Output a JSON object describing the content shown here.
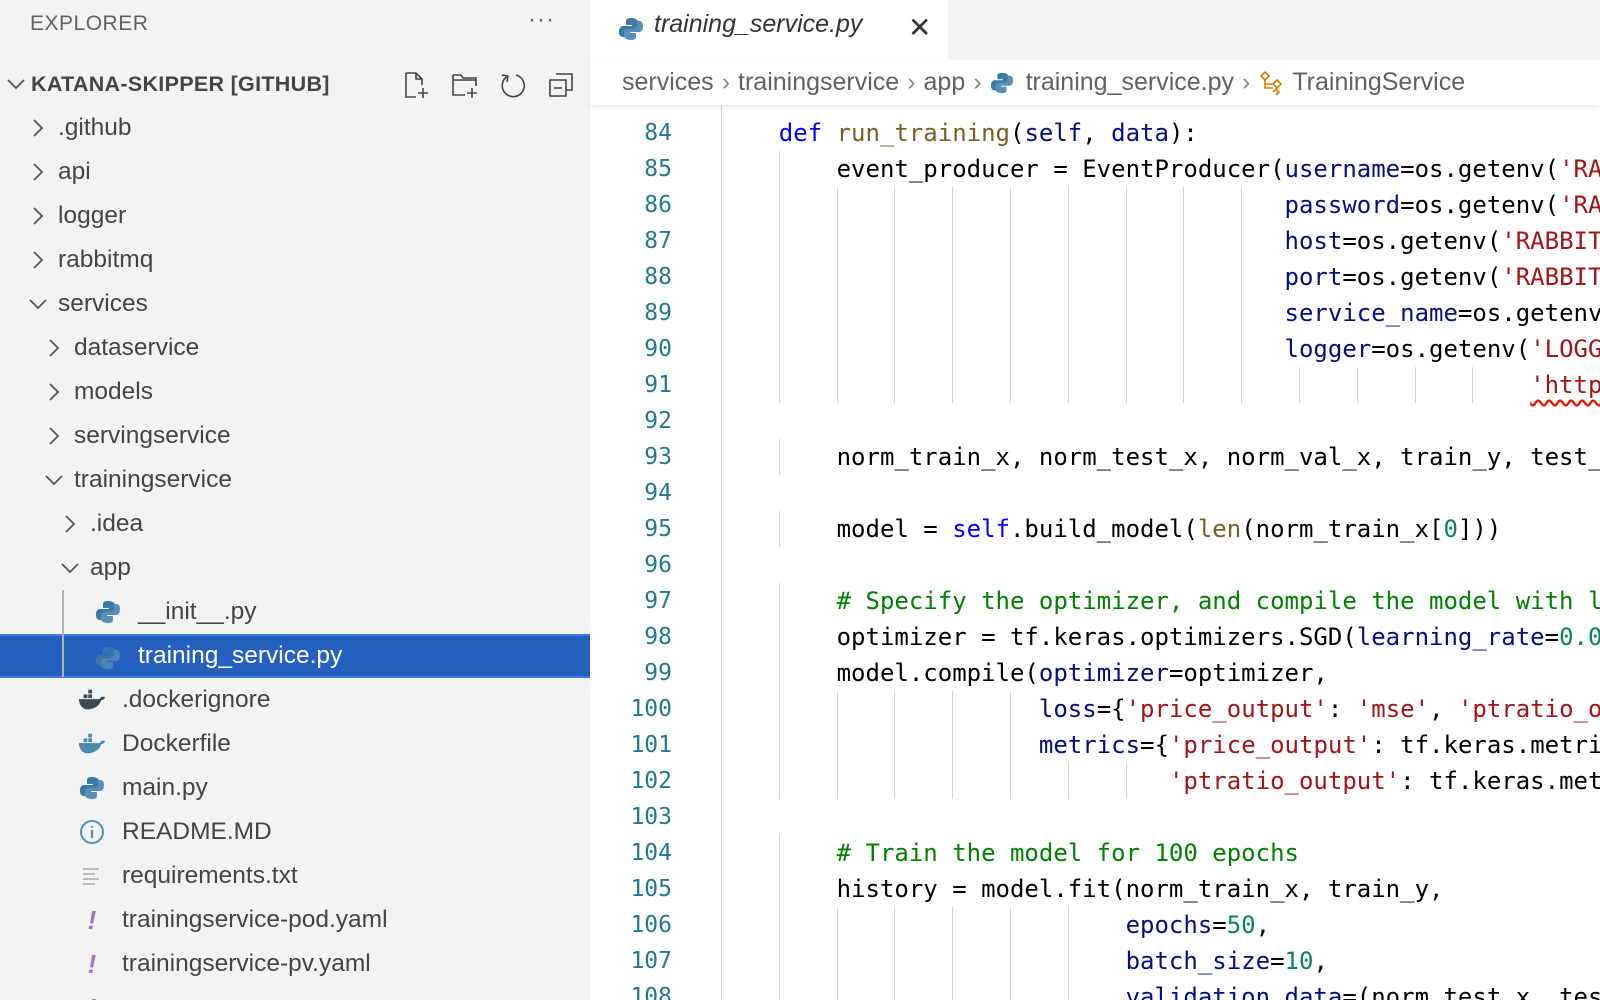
{
  "sidebar": {
    "title": "EXPLORER",
    "more_icon": "ellipsis-icon",
    "root_label": "KATANA-SKIPPER [GITHUB]",
    "actions": [
      "new-file-icon",
      "new-folder-icon",
      "refresh-icon",
      "collapse-all-icon"
    ],
    "items": [
      {
        "label": ".github",
        "depth": 0,
        "kind": "folder",
        "open": false
      },
      {
        "label": "api",
        "depth": 0,
        "kind": "folder",
        "open": false
      },
      {
        "label": "logger",
        "depth": 0,
        "kind": "folder",
        "open": false
      },
      {
        "label": "rabbitmq",
        "depth": 0,
        "kind": "folder",
        "open": false
      },
      {
        "label": "services",
        "depth": 0,
        "kind": "folder",
        "open": true
      },
      {
        "label": "dataservice",
        "depth": 1,
        "kind": "folder",
        "open": false
      },
      {
        "label": "models",
        "depth": 1,
        "kind": "folder",
        "open": false
      },
      {
        "label": "servingservice",
        "depth": 1,
        "kind": "folder",
        "open": false
      },
      {
        "label": "trainingservice",
        "depth": 1,
        "kind": "folder",
        "open": true
      },
      {
        "label": ".idea",
        "depth": 2,
        "kind": "folder",
        "open": false
      },
      {
        "label": "app",
        "depth": 2,
        "kind": "folder",
        "open": true
      },
      {
        "label": "__init__.py",
        "depth": 3,
        "kind": "python"
      },
      {
        "label": "training_service.py",
        "depth": 3,
        "kind": "python",
        "selected": true
      },
      {
        "label": ".dockerignore",
        "depth": 2,
        "kind": "docker-dark"
      },
      {
        "label": "Dockerfile",
        "depth": 2,
        "kind": "docker"
      },
      {
        "label": "main.py",
        "depth": 2,
        "kind": "python"
      },
      {
        "label": "README.MD",
        "depth": 2,
        "kind": "info"
      },
      {
        "label": "requirements.txt",
        "depth": 2,
        "kind": "text"
      },
      {
        "label": "trainingservice-pod.yaml",
        "depth": 2,
        "kind": "yaml"
      },
      {
        "label": "trainingservice-pv.yaml",
        "depth": 2,
        "kind": "yaml"
      },
      {
        "label": "",
        "depth": 2,
        "kind": "yaml"
      }
    ]
  },
  "tab": {
    "label": "training_service.py",
    "icon": "python-icon",
    "close_icon": "close-icon"
  },
  "breadcrumb": [
    "services",
    "trainingservice",
    "app",
    "training_service.py",
    "TrainingService"
  ],
  "colors": {
    "selection": "#2560c0",
    "line_number": "#237893",
    "keyword": "#0000ff",
    "function": "#795e26",
    "parameter": "#001080",
    "string": "#a31515",
    "number": "#098658",
    "comment": "#008000"
  },
  "code": {
    "first_line": 83,
    "lines": [
      [],
      [
        [
          "",
          "    "
        ],
        [
          "kw",
          "def"
        ],
        [
          "",
          " "
        ],
        [
          "fn",
          "run_training"
        ],
        [
          "",
          "("
        ],
        [
          "pa",
          "self"
        ],
        [
          "",
          ", "
        ],
        [
          "pa",
          "data"
        ],
        [
          "",
          "):"
        ]
      ],
      [
        [
          "",
          "        event_producer = EventProducer("
        ],
        [
          "pa",
          "username"
        ],
        [
          "",
          "=os.getenv("
        ],
        [
          "st",
          "'RA"
        ]
      ],
      [
        [
          "",
          "                                       "
        ],
        [
          "pa",
          "password"
        ],
        [
          "",
          "=os.getenv("
        ],
        [
          "st",
          "'RA"
        ]
      ],
      [
        [
          "",
          "                                       "
        ],
        [
          "pa",
          "host"
        ],
        [
          "",
          "=os.getenv("
        ],
        [
          "st",
          "'RABBIT"
        ]
      ],
      [
        [
          "",
          "                                       "
        ],
        [
          "pa",
          "port"
        ],
        [
          "",
          "=os.getenv("
        ],
        [
          "st",
          "'RABBIT"
        ]
      ],
      [
        [
          "",
          "                                       "
        ],
        [
          "pa",
          "service_name"
        ],
        [
          "",
          "=os.getenv"
        ]
      ],
      [
        [
          "",
          "                                       "
        ],
        [
          "pa",
          "logger"
        ],
        [
          "",
          "=os.getenv("
        ],
        [
          "st",
          "'LOGG"
        ]
      ],
      [
        [
          "",
          "                                                        "
        ],
        [
          "st sq",
          "'http"
        ]
      ],
      [],
      [
        [
          "",
          "        norm_train_x, norm_test_x, norm_val_x, train_y, test_"
        ]
      ],
      [],
      [
        [
          "",
          "        model = "
        ],
        [
          "kw",
          "self"
        ],
        [
          "",
          ".build_model("
        ],
        [
          "fn",
          "len"
        ],
        [
          "",
          "(norm_train_x["
        ],
        [
          "nu",
          "0"
        ],
        [
          "",
          "]))"
        ]
      ],
      [],
      [
        [
          "",
          "        "
        ],
        [
          "cm",
          "# Specify the optimizer, and compile the model with l"
        ]
      ],
      [
        [
          "",
          "        optimizer = tf.keras.optimizers.SGD("
        ],
        [
          "pa",
          "learning_rate"
        ],
        [
          "",
          "="
        ],
        [
          "nu",
          "0.0"
        ]
      ],
      [
        [
          "",
          "        model.compile("
        ],
        [
          "pa",
          "optimizer"
        ],
        [
          "",
          "=optimizer,"
        ]
      ],
      [
        [
          "",
          "                      "
        ],
        [
          "pa",
          "loss"
        ],
        [
          "",
          "={"
        ],
        [
          "st",
          "'price_output'"
        ],
        [
          "",
          ": "
        ],
        [
          "st",
          "'mse'"
        ],
        [
          "",
          ", "
        ],
        [
          "st",
          "'ptratio_o"
        ]
      ],
      [
        [
          "",
          "                      "
        ],
        [
          "pa",
          "metrics"
        ],
        [
          "",
          "={"
        ],
        [
          "st",
          "'price_output'"
        ],
        [
          "",
          ": tf.keras.metri"
        ]
      ],
      [
        [
          "",
          "                               "
        ],
        [
          "st",
          "'ptratio_output'"
        ],
        [
          "",
          ": tf.keras.met"
        ]
      ],
      [],
      [
        [
          "",
          "        "
        ],
        [
          "cm",
          "# Train the model for 100 epochs"
        ]
      ],
      [
        [
          "",
          "        history = model.fit(norm_train_x, train_y,"
        ]
      ],
      [
        [
          "",
          "                            "
        ],
        [
          "pa",
          "epochs"
        ],
        [
          "",
          "="
        ],
        [
          "nu",
          "50"
        ],
        [
          "",
          ","
        ]
      ],
      [
        [
          "",
          "                            "
        ],
        [
          "pa",
          "batch_size"
        ],
        [
          "",
          "="
        ],
        [
          "nu",
          "10"
        ],
        [
          "",
          ","
        ]
      ],
      [
        [
          "",
          "                            "
        ],
        [
          "pa",
          "validation_data"
        ],
        [
          "",
          "=(norm_test_x, tes"
        ]
      ]
    ]
  }
}
